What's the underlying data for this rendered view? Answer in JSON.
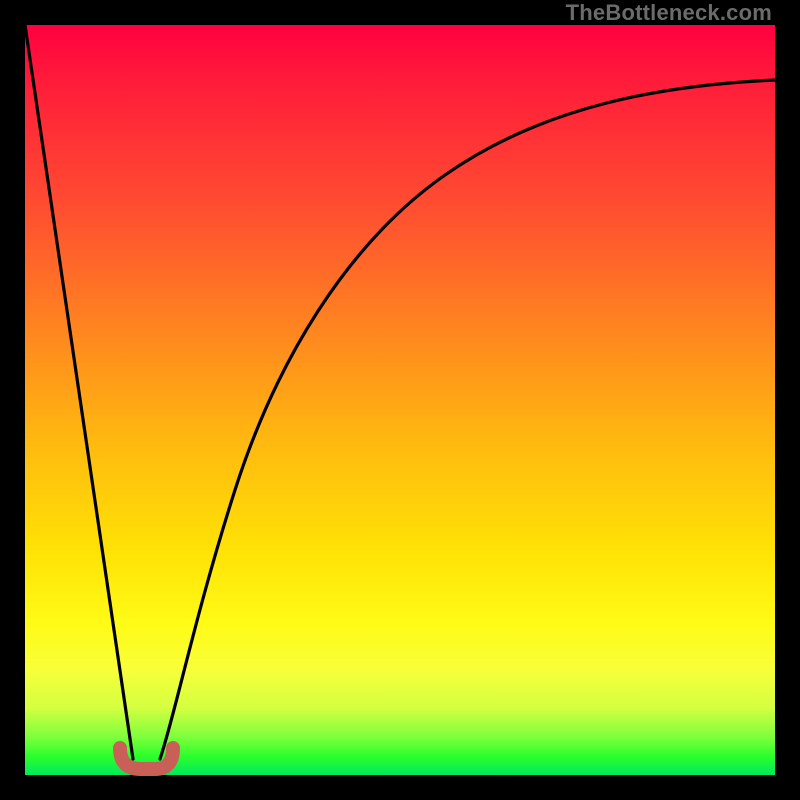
{
  "watermark": "TheBottleneck.com",
  "chart_data": {
    "type": "line",
    "title": "",
    "xlabel": "",
    "ylabel": "",
    "xlim": [
      0,
      100
    ],
    "ylim": [
      0,
      100
    ],
    "series": [
      {
        "name": "left-leg",
        "x": [
          0,
          14.5
        ],
        "values": [
          100,
          2
        ]
      },
      {
        "name": "right-leg",
        "x": [
          18,
          22,
          28,
          34,
          42,
          52,
          64,
          80,
          100
        ],
        "values": [
          2,
          18,
          38,
          53,
          66,
          76,
          83,
          88,
          92
        ]
      }
    ],
    "marker": {
      "name": "trough-marker",
      "x_range": [
        12.5,
        19.5
      ],
      "y": 2,
      "color": "#c86058"
    },
    "gradient_stops": [
      {
        "pos": 0,
        "color": "#ff0040"
      },
      {
        "pos": 0.25,
        "color": "#ff5030"
      },
      {
        "pos": 0.55,
        "color": "#ffb710"
      },
      {
        "pos": 0.8,
        "color": "#fffb17"
      },
      {
        "pos": 0.95,
        "color": "#7cff3c"
      },
      {
        "pos": 1.0,
        "color": "#00e85f"
      }
    ]
  }
}
